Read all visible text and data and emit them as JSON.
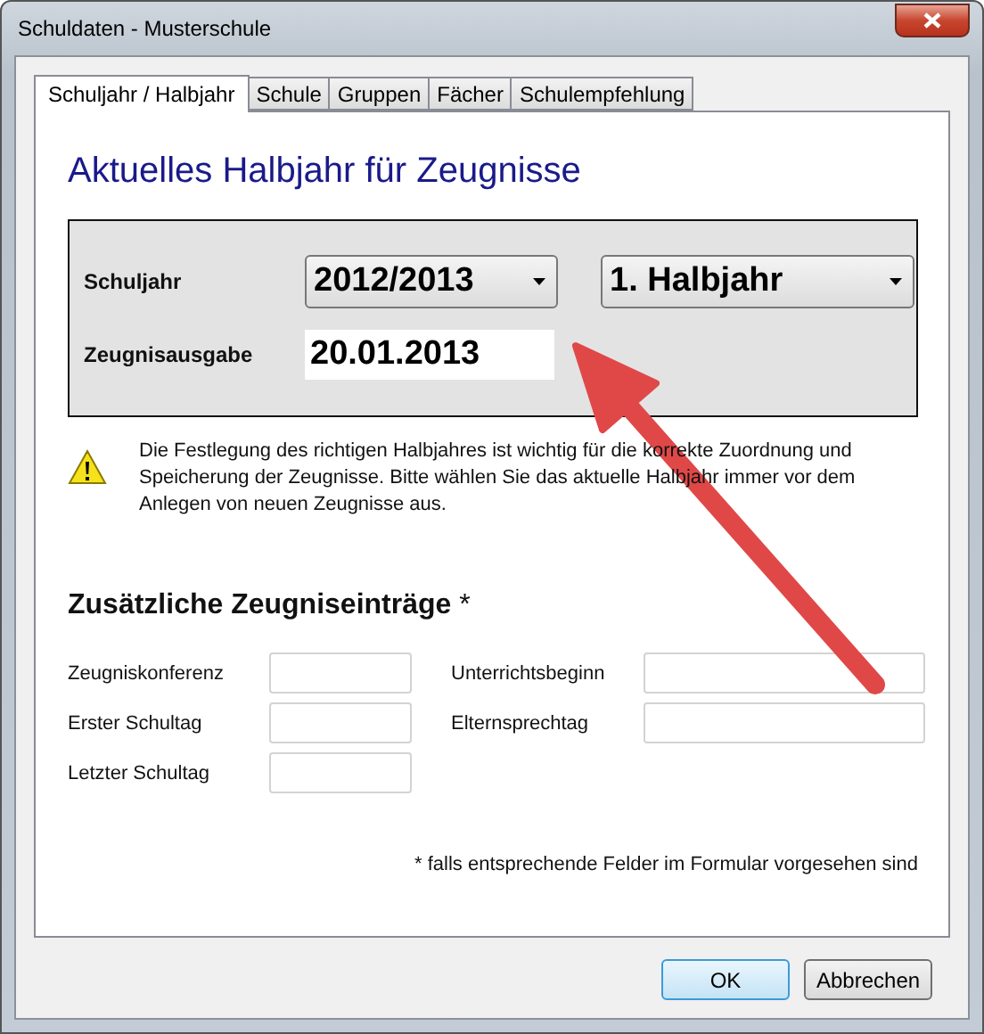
{
  "window": {
    "title": "Schuldaten - Musterschule"
  },
  "tabs": [
    {
      "label": "Schuljahr / Halbjahr",
      "selected": true
    },
    {
      "label": "Schule",
      "selected": false
    },
    {
      "label": "Gruppen",
      "selected": false
    },
    {
      "label": "Fächer",
      "selected": false
    },
    {
      "label": "Schulempfehlung",
      "selected": false
    }
  ],
  "heading": "Aktuelles Halbjahr für Zeugnisse",
  "period": {
    "school_year_label": "Schuljahr",
    "school_year": "2012/2013",
    "half_year": "1. Halbjahr",
    "issue_label": "Zeugnisausgabe",
    "issue_date": "20.01.2013"
  },
  "notice": "Die Festlegung des richtigen Halbjahres ist wichtig für die korrekte Zuordnung und Speicherung der Zeugnisse. Bitte wählen Sie das aktuelle Halbjahr immer vor dem Anlegen von neuen Zeugnisse aus.",
  "extra": {
    "title": "**Zusätzliche Zeugniseinträge** *",
    "left_fields": [
      {
        "label": "Zeugniskonferenz"
      },
      {
        "label": "Erster Schultag"
      },
      {
        "label": "Letzter Schultag"
      }
    ],
    "right_fields": [
      {
        "label": "Unterrichtsbeginn"
      },
      {
        "label": "Elternsprechtag"
      }
    ],
    "footnote": "* falls entsprechende Felder im Formular vorgesehen sind"
  },
  "buttons": [
    {
      "label": "OK",
      "default": true
    },
    {
      "label": "Abbrechen",
      "default": false
    }
  ]
}
